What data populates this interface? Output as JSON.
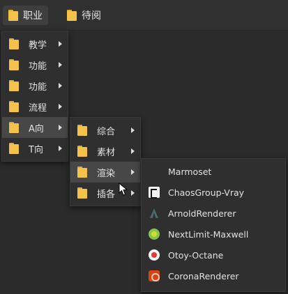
{
  "bookmarks": [
    {
      "label": "职业"
    },
    {
      "label": "待阅"
    }
  ],
  "menu1": {
    "items": [
      {
        "label": "教学",
        "icon": "folder-icon"
      },
      {
        "label": "功能",
        "icon": "folder-icon"
      },
      {
        "label": "功能",
        "icon": "folder-icon"
      },
      {
        "label": "流程",
        "icon": "folder-icon"
      },
      {
        "label": "A向",
        "icon": "folder-icon"
      },
      {
        "label": "T向",
        "icon": "folder-icon"
      }
    ]
  },
  "menu2": {
    "items": [
      {
        "label": "综合",
        "icon": "folder-icon"
      },
      {
        "label": "素材",
        "icon": "folder-icon"
      },
      {
        "label": "渲染",
        "icon": "folder-icon"
      },
      {
        "label": "插各",
        "icon": "folder-icon"
      }
    ]
  },
  "menu3": {
    "items": [
      {
        "label": "Marmoset",
        "icon": "marmoset-icon"
      },
      {
        "label": "ChaosGroup-Vray",
        "icon": "chaosgroup-icon"
      },
      {
        "label": "ArnoldRenderer",
        "icon": "arnold-icon"
      },
      {
        "label": "NextLimit-Maxwell",
        "icon": "maxwell-icon"
      },
      {
        "label": "Otoy-Octane",
        "icon": "octane-icon"
      },
      {
        "label": "CoronaRenderer",
        "icon": "corona-icon"
      }
    ]
  },
  "colors": {
    "background": "#2b2b2b",
    "menu_bg": "#2f2f2f",
    "highlight": "#474747",
    "folder": "#f2c24b"
  }
}
